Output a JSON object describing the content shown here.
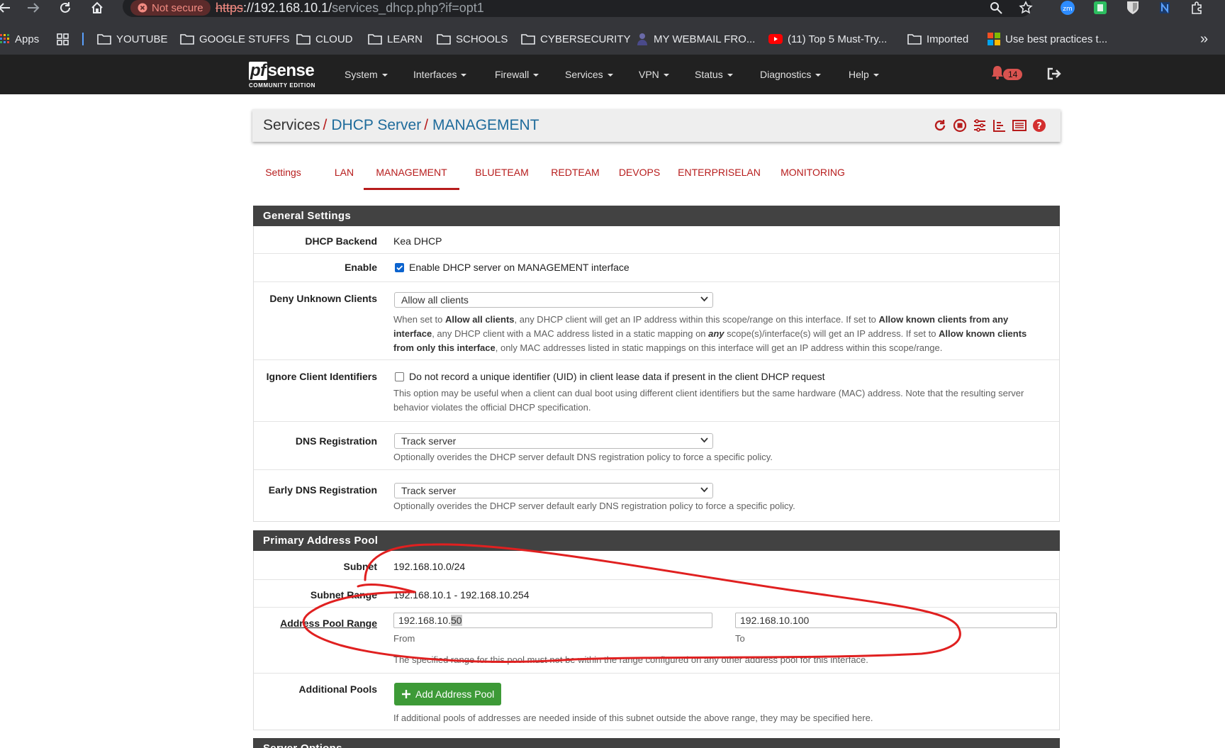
{
  "browser": {
    "security_label": "Not secure",
    "url_protocol": "https",
    "url_host_path": "://192.168.10.1/",
    "url_rest": "services_dhcp.php?if=opt1",
    "extensions": [
      "zm"
    ],
    "bookmarks": [
      {
        "label": "Apps",
        "icon": "apps-grid-icon"
      },
      {
        "label": "",
        "icon": "tab-groups-icon"
      },
      {
        "label": "YOUTUBE",
        "icon": "folder-icon"
      },
      {
        "label": "GOOGLE STUFFS",
        "icon": "folder-icon"
      },
      {
        "label": "CLOUD",
        "icon": "folder-icon"
      },
      {
        "label": "LEARN",
        "icon": "folder-icon"
      },
      {
        "label": "SCHOOLS",
        "icon": "folder-icon"
      },
      {
        "label": "CYBERSECURITY",
        "icon": "folder-icon"
      },
      {
        "label": "MY WEBMAIL FRO...",
        "icon": "webmail-icon"
      },
      {
        "label": "(11) Top 5 Must-Try...",
        "icon": "youtube-icon"
      },
      {
        "label": "Imported",
        "icon": "folder-icon"
      },
      {
        "label": "Use best practices t...",
        "icon": "microsoft-icon"
      }
    ],
    "overflow": "»"
  },
  "navbar": {
    "logo_pf": "pf",
    "logo_sense": "sense",
    "logo_sub": "COMMUNITY EDITION",
    "menu": [
      "System",
      "Interfaces",
      "Firewall",
      "Services",
      "VPN",
      "Status",
      "Diagnostics",
      "Help"
    ],
    "notification_count": "14"
  },
  "breadcrumb": {
    "items": [
      "Services",
      "DHCP Server",
      "MANAGEMENT"
    ],
    "separator": "/"
  },
  "tabs": {
    "items": [
      "Settings",
      "LAN",
      "MANAGEMENT",
      "BLUETEAM",
      "REDTEAM",
      "DEVOPS",
      "ENTERPRISELAN",
      "MONITORING"
    ],
    "active": "MANAGEMENT"
  },
  "general_settings": {
    "title": "General Settings",
    "backend_label": "DHCP Backend",
    "backend_value": "Kea DHCP",
    "enable_label": "Enable",
    "enable_checked": true,
    "enable_text": "Enable DHCP server on MANAGEMENT interface",
    "deny_label": "Deny Unknown Clients",
    "deny_value": "Allow all clients",
    "deny_help": {
      "p1": "When set to ",
      "b1": "Allow all clients",
      "p2": ", any DHCP client will get an IP address within this scope/range on this interface. If set to ",
      "b2": "Allow known clients from any interface",
      "p3": ", any DHCP client with a MAC address listed in a static mapping on ",
      "b3": "any",
      "p4": " scope(s)/interface(s) will get an IP address. If set to ",
      "b4": "Allow known clients from only this interface",
      "p5": ", only MAC addresses listed in static mappings on this interface will get an IP address within this scope/range."
    },
    "ignore_label": "Ignore Client Identifiers",
    "ignore_checked": false,
    "ignore_text": "Do not record a unique identifier (UID) in client lease data if present in the client DHCP request",
    "ignore_help": "This option may be useful when a client can dual boot using different client identifiers but the same hardware (MAC) address. Note that the resulting server behavior violates the official DHCP specification.",
    "dns_label": "DNS Registration",
    "dns_value": "Track server",
    "dns_help": "Optionally overides the DHCP server default DNS registration policy to force a specific policy.",
    "early_dns_label": "Early DNS Registration",
    "early_dns_value": "Track server",
    "early_dns_help": "Optionally overides the DHCP server default early DNS registration policy to force a specific policy."
  },
  "primary_pool": {
    "title": "Primary Address Pool",
    "subnet_label": "Subnet",
    "subnet_value": "192.168.10.0/24",
    "range_label": "Subnet Range",
    "range_value": "192.168.10.1 - 192.168.10.254",
    "pool_label": "Address Pool Range",
    "from_prefix": "192.168.10.",
    "from_selected": "50",
    "from_caption": "From",
    "to_value": "192.168.10.100",
    "to_caption": "To",
    "pool_help": "The specified range for this pool must not be within the range configured on any other address pool for this interface.",
    "additional_label": "Additional Pools",
    "add_button": "Add Address Pool",
    "additional_help": "If additional pools of addresses are needed inside of this subnet outside the above range, they may be specified here."
  },
  "server_options": {
    "title": "Server Options"
  },
  "colors": {
    "accent_red": "#b71c1c",
    "link_blue": "#1e6b9b",
    "panel_header": "#424242",
    "navbar": "#212121",
    "success_green": "#3d9a37",
    "annotation_red": "#e02020"
  }
}
